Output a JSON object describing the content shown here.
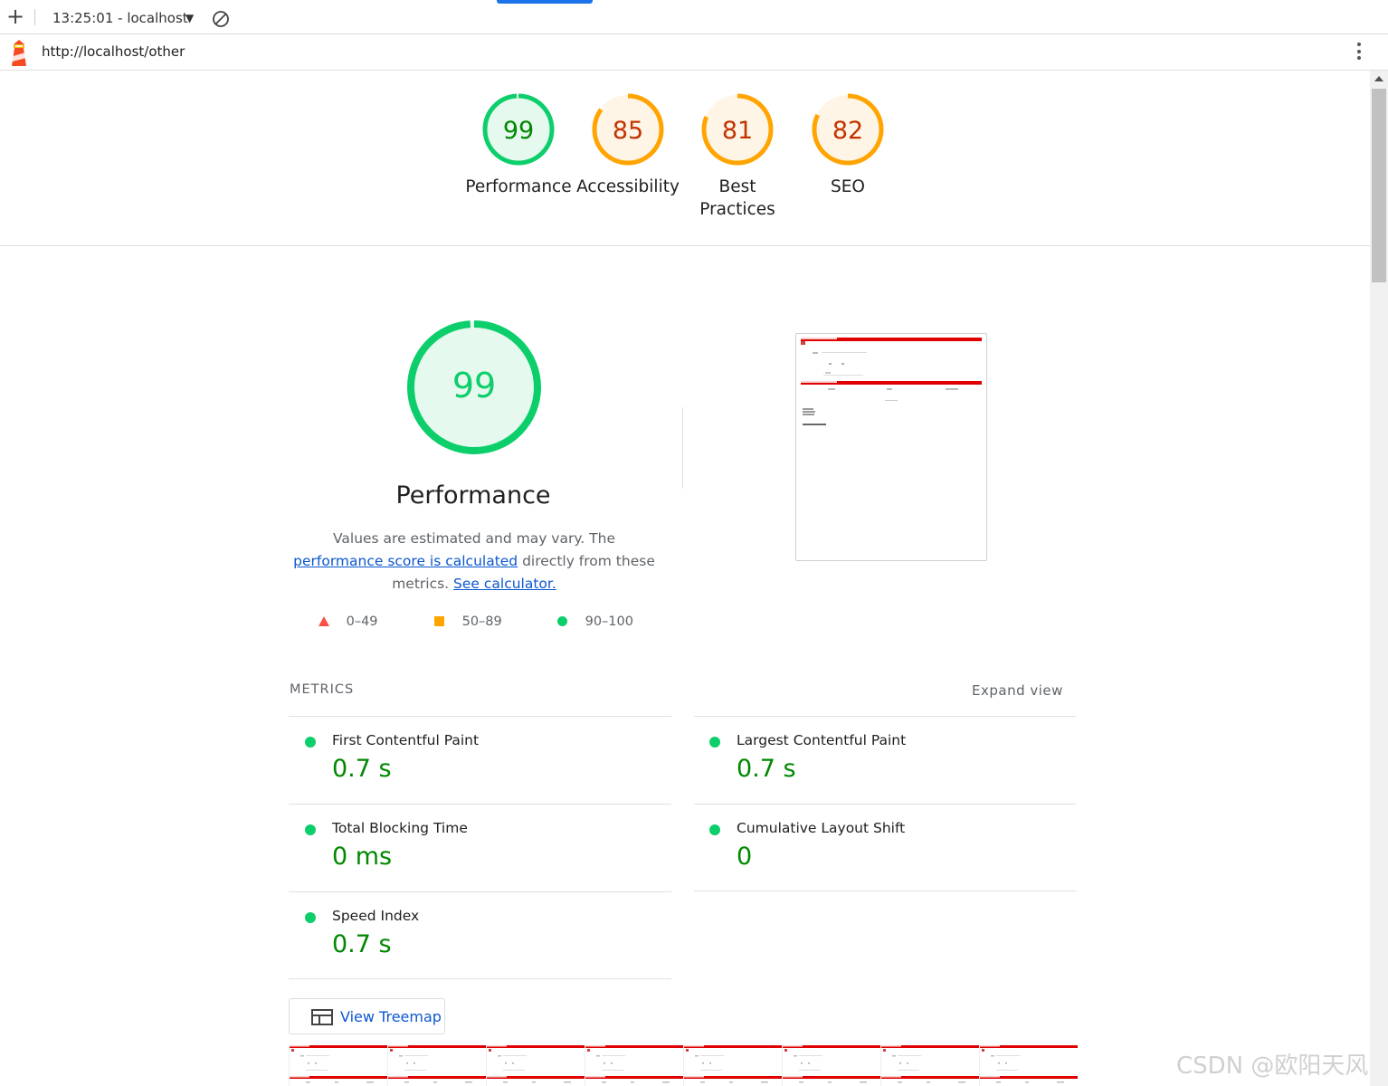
{
  "toolbar": {
    "report_select": "13:25:01 - localhost"
  },
  "url": "http://localhost/other",
  "gauges": [
    {
      "label": "Performance",
      "score": "99",
      "score_value": 99,
      "color": "#0cce6b",
      "text_color": "#008800",
      "fill": "#e6f9ee"
    },
    {
      "label": "Accessibility",
      "score": "85",
      "score_value": 85,
      "color": "#ffa400",
      "text_color": "#c33300",
      "fill": "#fff5e6"
    },
    {
      "label_line1": "Best",
      "label_line2": "Practices",
      "score": "81",
      "score_value": 81,
      "color": "#ffa400",
      "text_color": "#c33300",
      "fill": "#fff5e6"
    },
    {
      "label": "SEO",
      "score": "82",
      "score_value": 82,
      "color": "#ffa400",
      "text_color": "#c33300",
      "fill": "#fff5e6"
    }
  ],
  "performance": {
    "score": "99",
    "score_value": 99,
    "title": "Performance",
    "desc_text1": "Values are estimated and may vary. The ",
    "desc_link1": "performance score is calculated",
    "desc_text2": " directly from these metrics. ",
    "desc_link2": "See calculator."
  },
  "legend": [
    {
      "range": "0–49",
      "color": "#ff4e42"
    },
    {
      "range": "50–89",
      "color": "#ffa400"
    },
    {
      "range": "90–100",
      "color": "#0cce6b"
    }
  ],
  "metrics": {
    "heading": "METRICS",
    "expand_label": "Expand view",
    "items": [
      {
        "name": "First Contentful Paint",
        "value": "0.7 s"
      },
      {
        "name": "Largest Contentful Paint",
        "value": "0.7 s"
      },
      {
        "name": "Total Blocking Time",
        "value": "0 ms"
      },
      {
        "name": "Cumulative Layout Shift",
        "value": "0"
      },
      {
        "name": "Speed Index",
        "value": "0.7 s"
      }
    ]
  },
  "treemap_label": "View Treemap",
  "watermark": "CSDN @欧阳天风",
  "colors": {
    "link": "#0b57d0",
    "pass": "#0cce6b",
    "average": "#ffa400",
    "fail": "#ff4e42"
  }
}
